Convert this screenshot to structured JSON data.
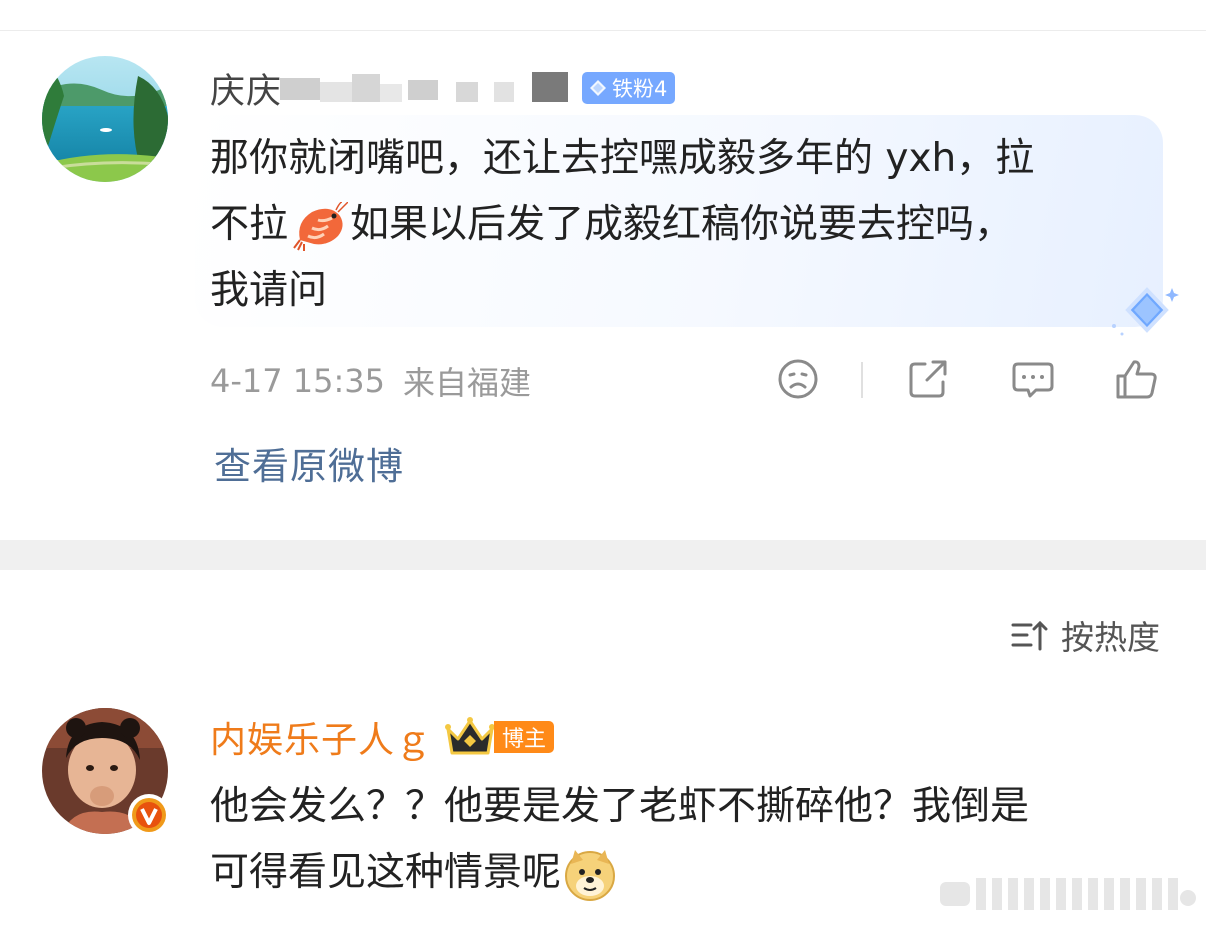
{
  "comment1": {
    "username_visible": "庆庆",
    "fan_badge": "铁粉4",
    "text_line1": "那你就闭嘴吧，还让去控嘿成毅多年的 yxh，拉",
    "text_line2a": "不拉",
    "text_line2b": "如果以后发了成毅红稿你说要去控吗，",
    "text_line3": "我请问",
    "inline_emoji": "shrimp-emoji",
    "timestamp": "4-17 15:35",
    "location": "来自福建",
    "actions": [
      "dislike-icon",
      "share-icon",
      "comment-icon",
      "like-icon"
    ],
    "view_original": "查看原微博"
  },
  "sort": {
    "label": "按热度",
    "icon": "sort-icon"
  },
  "comment2": {
    "username": "内娱乐子人ｇ",
    "badge_label": "博主",
    "text_line1": "他会发么？？他要是发了老虾不撕碎他？我倒是",
    "text_line2": "可得看见这种情景呢",
    "inline_emoji": "doge-emoji",
    "verified_badge": "V"
  },
  "colors": {
    "fan_badge": "#76a8ff",
    "blogger_name": "#ef7b1a",
    "link": "#4f6e96",
    "meta": "#9a9a9a"
  }
}
